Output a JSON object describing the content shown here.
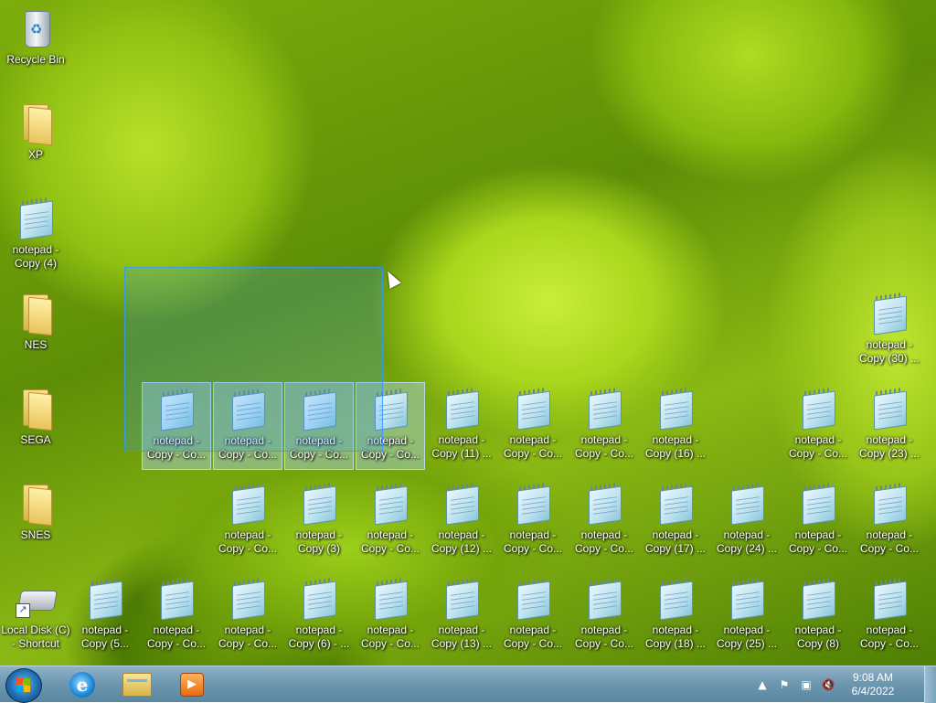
{
  "desktop": {
    "left_icons": [
      {
        "label": "Recycle Bin",
        "kind": "recycle",
        "icon": "recycle-bin-icon"
      },
      {
        "label": "XP",
        "kind": "folder",
        "icon": "folder-icon"
      },
      {
        "label": "notepad -\nCopy (4)",
        "kind": "notepad",
        "icon": "notepad-icon"
      },
      {
        "label": "NES",
        "kind": "folder",
        "icon": "folder-icon"
      },
      {
        "label": "SEGA",
        "kind": "folder",
        "icon": "folder-icon"
      },
      {
        "label": "SNES",
        "kind": "folder",
        "icon": "folder-icon"
      },
      {
        "label": "Local Disk (C)\n- Shortcut",
        "kind": "drive",
        "icon": "drive-shortcut-icon"
      }
    ],
    "right_icons": [
      {
        "label": "notepad -\nCopy (30) ...",
        "kind": "notepad",
        "icon": "notepad-icon"
      }
    ],
    "row_1": [
      {
        "label": "notepad -\nCopy - Co...",
        "selected": true
      },
      {
        "label": "notepad -\nCopy - Co...",
        "selected": true
      },
      {
        "label": "notepad -\nCopy - Co...",
        "selected": true
      },
      {
        "label": "notepad -\nCopy - Co...",
        "selected": true
      },
      {
        "label": "notepad -\nCopy (11) ...",
        "selected": false
      },
      {
        "label": "notepad -\nCopy - Co...",
        "selected": false
      },
      {
        "label": "notepad -\nCopy - Co...",
        "selected": false
      },
      {
        "label": "notepad -\nCopy (16) ...",
        "selected": false
      },
      {
        "label": "",
        "selected": false
      },
      {
        "label": "notepad -\nCopy - Co...",
        "selected": false
      },
      {
        "label": "notepad -\nCopy (23) ...",
        "selected": false
      }
    ],
    "row_2": [
      {
        "label": "notepad -\nCopy - Co..."
      },
      {
        "label": "notepad -\nCopy (3)"
      },
      {
        "label": "notepad -\nCopy - Co..."
      },
      {
        "label": "notepad -\nCopy (12) ..."
      },
      {
        "label": "notepad -\nCopy - Co..."
      },
      {
        "label": "notepad -\nCopy - Co..."
      },
      {
        "label": "notepad -\nCopy (17) ..."
      },
      {
        "label": "notepad -\nCopy (24) ..."
      },
      {
        "label": "notepad -\nCopy - Co..."
      },
      {
        "label": "notepad -\nCopy - Co..."
      }
    ],
    "row_3": [
      {
        "label": "notepad -\nCopy (5..."
      },
      {
        "label": "notepad -\nCopy - Co..."
      },
      {
        "label": "notepad -\nCopy - Co..."
      },
      {
        "label": "notepad -\nCopy (6) - ..."
      },
      {
        "label": "notepad -\nCopy - Co..."
      },
      {
        "label": "notepad -\nCopy (13) ..."
      },
      {
        "label": "notepad -\nCopy - Co..."
      },
      {
        "label": "notepad -\nCopy - Co..."
      },
      {
        "label": "notepad -\nCopy (18) ..."
      },
      {
        "label": "notepad -\nCopy (25) ..."
      },
      {
        "label": "notepad -\nCopy (8)"
      },
      {
        "label": "notepad -\nCopy - Co..."
      }
    ]
  },
  "taskbar": {
    "pinned": [
      {
        "name": "internet-explorer",
        "glyph": "e"
      },
      {
        "name": "windows-explorer",
        "glyph": ""
      },
      {
        "name": "media-player",
        "glyph": "▶"
      }
    ],
    "tray": {
      "show_hidden": "▲",
      "flag": "⚑",
      "network": "▣",
      "volume": "🔇"
    },
    "clock": {
      "time": "9:08 AM",
      "date": "6/4/2022"
    }
  }
}
